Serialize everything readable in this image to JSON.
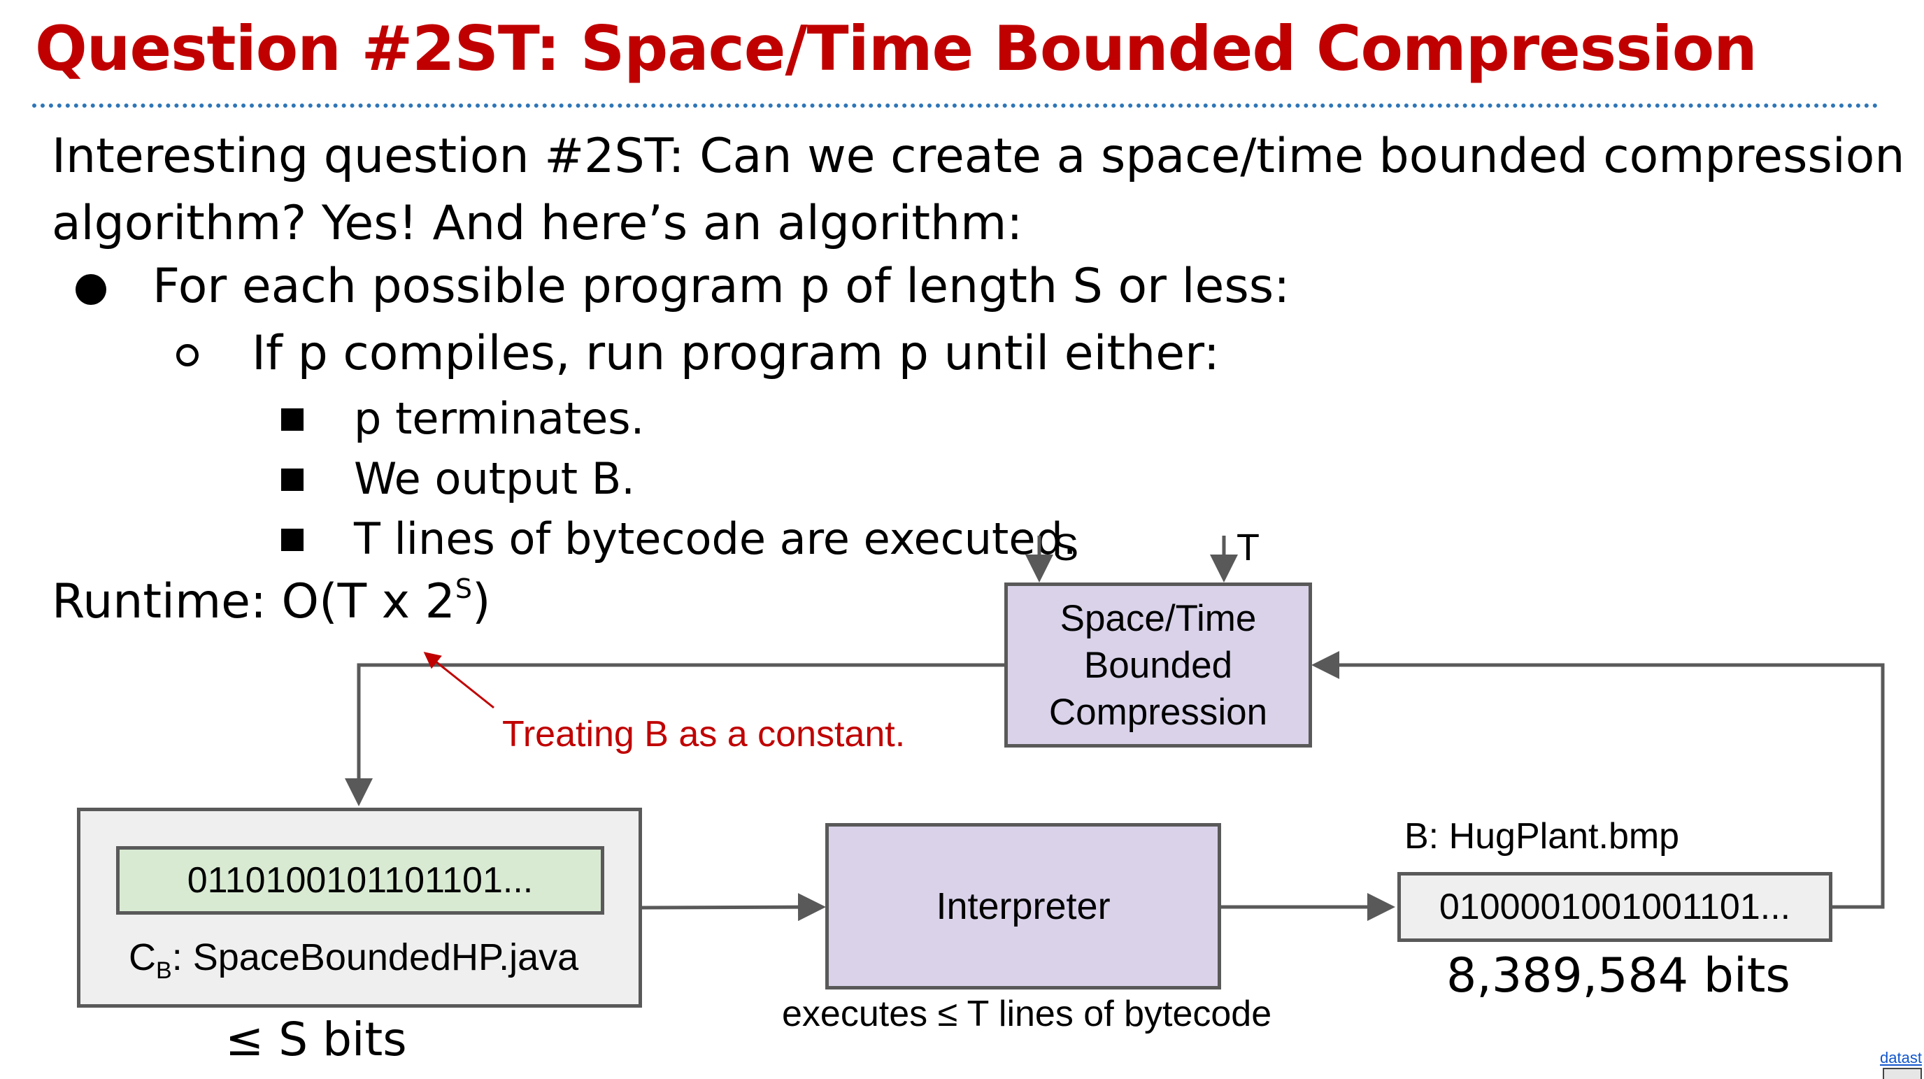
{
  "slide": {
    "title": "Question #2ST: Space/Time Bounded Compression",
    "intro_line1": "Interesting question #2ST: Can we create a space/time bounded compression",
    "intro_line2": "algorithm? Yes! And here’s an algorithm:",
    "bullet1": "For each possible program p of length S or less:",
    "bullet2": "If p compiles, run program p until either:",
    "bullet3": [
      "p terminates.",
      "We output B.",
      "T lines of bytecode are executed."
    ],
    "runtime_prefix": "Runtime: O(T x 2",
    "runtime_sup": "S",
    "runtime_suffix": ")"
  },
  "diagram": {
    "compression_box": [
      "Space/Time",
      "Bounded",
      "Compression"
    ],
    "input_s": "S",
    "input_t": "T",
    "annotation": "Treating B as a constant.",
    "program_bits": "0110100101101101...",
    "program_name_prefix": "C",
    "program_name_sub": "B",
    "program_name_suffix": ": SpaceBoundedHP.java",
    "program_size": "≤ S bits",
    "interpreter": "Interpreter",
    "interpreter_caption": "executes ≤ T lines of bytecode",
    "output_label": "B: HugPlant.bmp",
    "output_bits": "0100001001001101...",
    "output_size": "8,389,584 bits"
  },
  "colors": {
    "title": "#c00000",
    "annotation": "#c00000",
    "dotted_rule": "#2e75b6",
    "box_purple": "#d9d2e9",
    "box_green": "#d9ead3",
    "box_grey": "#efefef",
    "arrow": "#595959"
  },
  "footer": {
    "corner_text": "datast"
  }
}
